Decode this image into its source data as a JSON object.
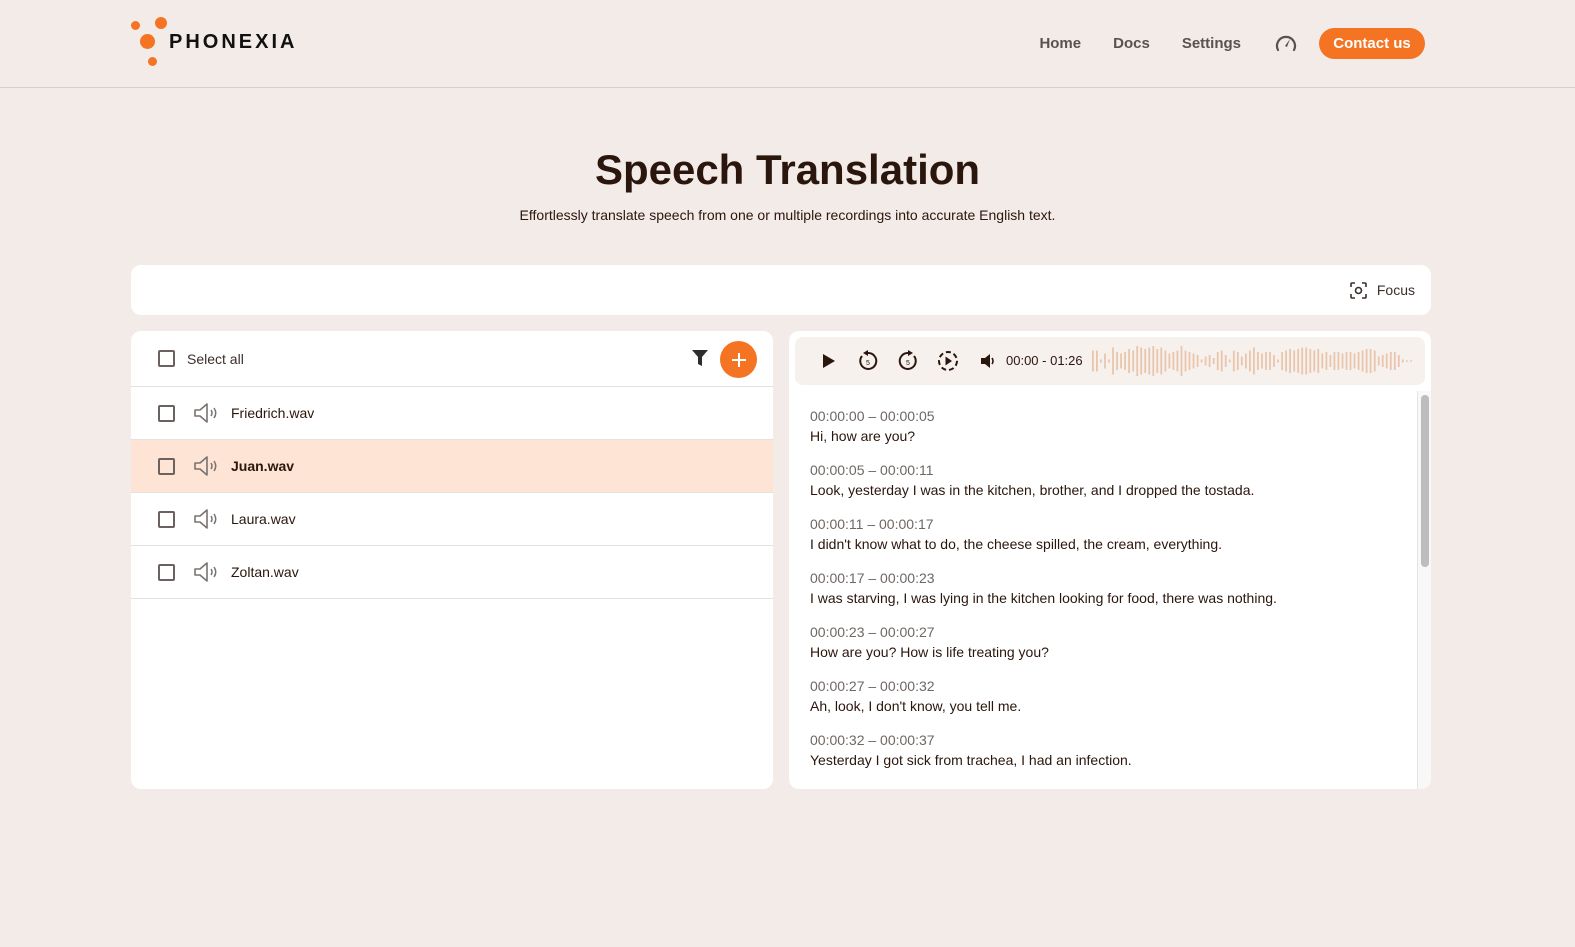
{
  "brand": {
    "name": "PHONEXIA",
    "accent": "#f47424"
  },
  "nav": {
    "links": [
      "Home",
      "Docs",
      "Settings"
    ],
    "status_icon": "gauge-icon",
    "contact_label": "Contact us"
  },
  "hero": {
    "title": "Speech Translation",
    "subtitle": "Effortlessly translate speech from one or multiple recordings into accurate English text."
  },
  "toolbar": {
    "focus_label": "Focus",
    "focus_icon": "focus-icon"
  },
  "file_list": {
    "select_all_label": "Select all",
    "filter_icon": "filter-icon",
    "add_icon": "plus-icon",
    "files": [
      {
        "name": "Friedrich.wav",
        "selected": false,
        "active": false
      },
      {
        "name": "Juan.wav",
        "selected": false,
        "active": true
      },
      {
        "name": "Laura.wav",
        "selected": false,
        "active": false
      },
      {
        "name": "Zoltan.wav",
        "selected": false,
        "active": false
      }
    ]
  },
  "player": {
    "time_readout": "00:00 - 01:26",
    "controls": [
      "play-icon",
      "rewind-5-icon",
      "forward-5-icon",
      "play-segment-icon",
      "volume-icon"
    ]
  },
  "transcript": {
    "segments": [
      {
        "time": "00:00:00 – 00:00:05",
        "text": "Hi, how are you?"
      },
      {
        "time": "00:00:05 – 00:00:11",
        "text": "Look, yesterday I was in the kitchen, brother, and I dropped the tostada."
      },
      {
        "time": "00:00:11 – 00:00:17",
        "text": "I didn't know what to do, the cheese spilled, the cream, everything."
      },
      {
        "time": "00:00:17 – 00:00:23",
        "text": "I was starving, I was lying in the kitchen looking for food, there was nothing."
      },
      {
        "time": "00:00:23 – 00:00:27",
        "text": "How are you? How is life treating you?"
      },
      {
        "time": "00:00:27 – 00:00:32",
        "text": "Ah, look, I don't know, you tell me."
      },
      {
        "time": "00:00:32 – 00:00:37",
        "text": "Yesterday I got sick from trachea, I had an infection."
      }
    ]
  }
}
